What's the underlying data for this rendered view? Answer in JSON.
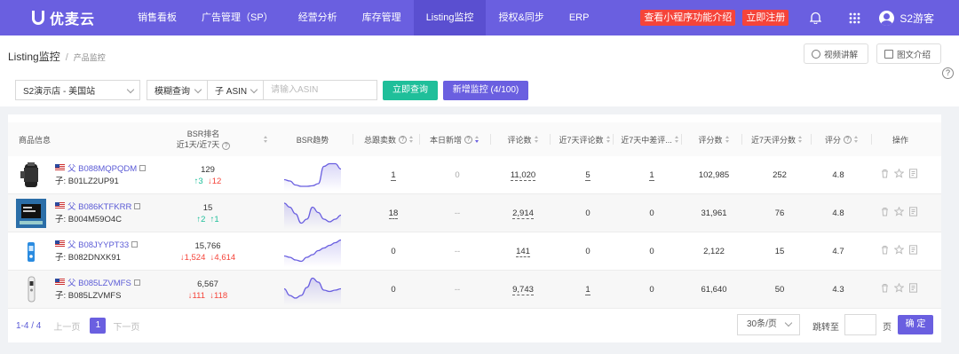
{
  "app": {
    "name": "优麦云"
  },
  "nav": [
    {
      "label": "销售看板",
      "active": false
    },
    {
      "label": "广告管理（SP）",
      "active": false
    },
    {
      "label": "经营分析",
      "active": false
    },
    {
      "label": "库存管理",
      "active": false
    },
    {
      "label": "Listing监控",
      "active": true
    },
    {
      "label": "授权&同步",
      "active": false
    },
    {
      "label": "ERP",
      "active": false
    }
  ],
  "top": {
    "promo": "查看小程序功能介绍",
    "register": "立即注册",
    "user": "S2游客"
  },
  "breadcrumb": {
    "main": "Listing监控",
    "sub": "产品监控"
  },
  "help": {
    "video": "视频讲解",
    "doc": "图文介绍"
  },
  "filter": {
    "store": "S2演示店 - 美国站",
    "match": "模糊查询",
    "field": "子 ASIN",
    "placeholder": "请输入ASIN",
    "query": "立即查询",
    "add": "新增监控 (4/100)"
  },
  "columns": {
    "product": "商品信息",
    "bsr_line1": "BSR排名",
    "bsr_line2": "近1天/近7天",
    "trend": "BSR趋势",
    "sales": "总跟卖数",
    "new_today": "本日新增",
    "reviews": "评论数",
    "reviews7": "近7天评论数",
    "bad7": "近7天中差评...",
    "ratings": "评分数",
    "ratings7": "近7天评分数",
    "score": "评分",
    "ops": "操作"
  },
  "rows": [
    {
      "parent": "父 B088MQPQDM",
      "child": "子: B01LZ2UP91",
      "bsr": "129",
      "d1": "↑3",
      "d1dir": "up",
      "d7": "↓12",
      "d7dir": "down",
      "sales": "1",
      "new_today": "0",
      "reviews": "11,020",
      "reviews7": "5",
      "bad7": "1",
      "ratings": "102,985",
      "ratings7": "252",
      "score": "4.8",
      "trend": [
        0.35,
        0.3,
        0.15,
        0.1,
        0.1,
        0.12,
        0.2,
        0.85,
        0.95,
        0.95,
        0.75
      ]
    },
    {
      "parent": "父 B086KTFKRR",
      "child": "子: B004M59O4C",
      "bsr": "15",
      "d1": "↑2",
      "d1dir": "up",
      "d7": "↑1",
      "d7dir": "up",
      "sales": "18",
      "new_today": "--",
      "reviews": "2,914",
      "reviews7": "0",
      "bad7": "0",
      "ratings": "31,961",
      "ratings7": "76",
      "score": "4.8",
      "trend": [
        0.9,
        0.75,
        0.5,
        0.15,
        0.3,
        0.75,
        0.55,
        0.3,
        0.2,
        0.3,
        0.45
      ]
    },
    {
      "parent": "父 B08JYYPT33",
      "child": "子: B082DNXK91",
      "bsr": "15,766",
      "d1": "↓1,524",
      "d1dir": "down",
      "d7": "↓4,614",
      "d7dir": "down",
      "sales": "0",
      "new_today": "--",
      "reviews": "141",
      "reviews7": "0",
      "bad7": "0",
      "ratings": "2,122",
      "ratings7": "15",
      "score": "4.7",
      "trend": [
        0.35,
        0.3,
        0.2,
        0.15,
        0.3,
        0.4,
        0.55,
        0.65,
        0.75,
        0.85,
        0.95
      ]
    },
    {
      "parent": "父 B085LZVMFS",
      "child": "子: B085LZVMFS",
      "bsr": "6,567",
      "d1": "↓111",
      "d1dir": "down",
      "d7": "↓118",
      "d7dir": "down",
      "sales": "0",
      "new_today": "--",
      "reviews": "9,743",
      "reviews7": "1",
      "bad7": "0",
      "ratings": "61,640",
      "ratings7": "50",
      "score": "4.3",
      "trend": [
        0.55,
        0.3,
        0.2,
        0.3,
        0.6,
        0.95,
        0.8,
        0.5,
        0.45,
        0.5,
        0.55
      ]
    }
  ],
  "pager": {
    "count": "1-4 / 4",
    "prev": "上一页",
    "page": "1",
    "next": "下一页",
    "size": "30条/页",
    "jump": "跳转至",
    "unit": "页",
    "confirm": "确 定"
  },
  "colors": {
    "accent": "#6a5fe0",
    "green": "#1fbf9a",
    "red": "#f5443a"
  }
}
